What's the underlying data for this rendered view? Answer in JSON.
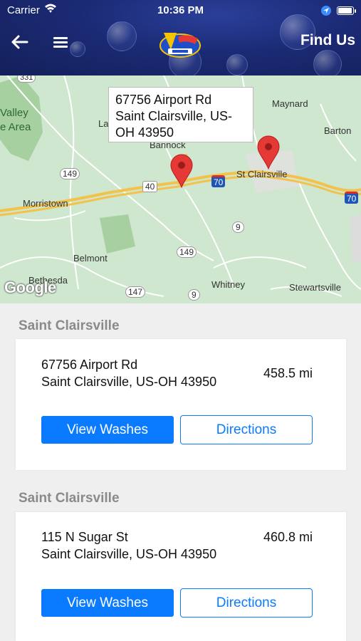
{
  "status_bar": {
    "carrier": "Carrier",
    "time": "10:36 PM"
  },
  "header": {
    "title": "Find Us",
    "back_icon": "back-arrow-icon",
    "menu_icon": "hamburger-menu-icon",
    "logo_text": "Valley Car Wash"
  },
  "map": {
    "callout_line1": "67756 Airport Rd",
    "callout_line2": "Saint Clairsville, US-",
    "callout_line3": "OH  43950",
    "labels": {
      "valley": "Valley",
      "e_area": "e Area",
      "la": "La",
      "bannock": "Bannock",
      "maynard": "Maynard",
      "barton": "Barton",
      "st_clairsville": "St Clairsville",
      "morristown": "Morristown",
      "belmont": "Belmont",
      "bethesda": "Bethesda",
      "whitney": "Whitney",
      "stewartsville": "Stewartsville"
    },
    "shields": {
      "r331": "331",
      "r149a": "149",
      "r40": "40",
      "r70a": "70",
      "r70b": "70",
      "r9a": "9",
      "r149b": "149",
      "r147": "147",
      "r9b": "9"
    },
    "google": "Google"
  },
  "locations": [
    {
      "section": "Saint Clairsville",
      "address_line1": "67756 Airport Rd",
      "address_line2": "Saint Clairsville, US-OH  43950",
      "distance": "458.5 mi",
      "view_label": "View Washes",
      "directions_label": "Directions"
    },
    {
      "section": "Saint Clairsville",
      "address_line1": "115 N Sugar St",
      "address_line2": "Saint Clairsville, US-OH  43950",
      "distance": "460.8 mi",
      "view_label": "View Washes",
      "directions_label": "Directions"
    }
  ],
  "colors": {
    "header_bg": "#1b2a74",
    "accent": "#0a7bff",
    "section_text": "#8a8a8a",
    "map_green": "#cfe6cf",
    "pin": "#e53935"
  }
}
